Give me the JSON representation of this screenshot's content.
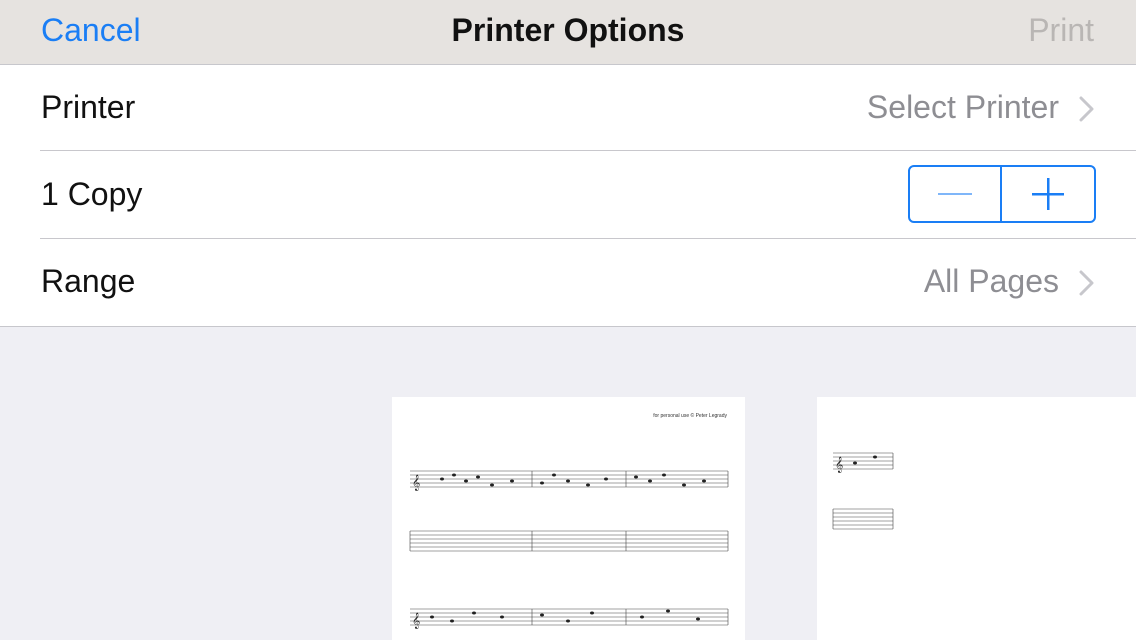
{
  "navbar": {
    "cancel_label": "Cancel",
    "title": "Printer Options",
    "print_label": "Print"
  },
  "options": {
    "printer": {
      "label": "Printer",
      "value": "Select Printer",
      "icon": "chevron-right-icon"
    },
    "copies": {
      "label": "1 Copy",
      "minus_icon": "minus-icon",
      "plus_icon": "plus-icon"
    },
    "range": {
      "label": "Range",
      "value": "All Pages",
      "icon": "chevron-right-icon"
    }
  },
  "preview": {
    "pages": [
      {
        "copyright": "for personal use © Peter Legrady"
      },
      {
        "copyright": ""
      }
    ]
  },
  "colors": {
    "accent": "#1a7ef5",
    "disabled": "#b9b6b4",
    "secondary_text": "#8e8e93",
    "navbar_bg": "#e6e3e0",
    "background": "#efeff4"
  }
}
